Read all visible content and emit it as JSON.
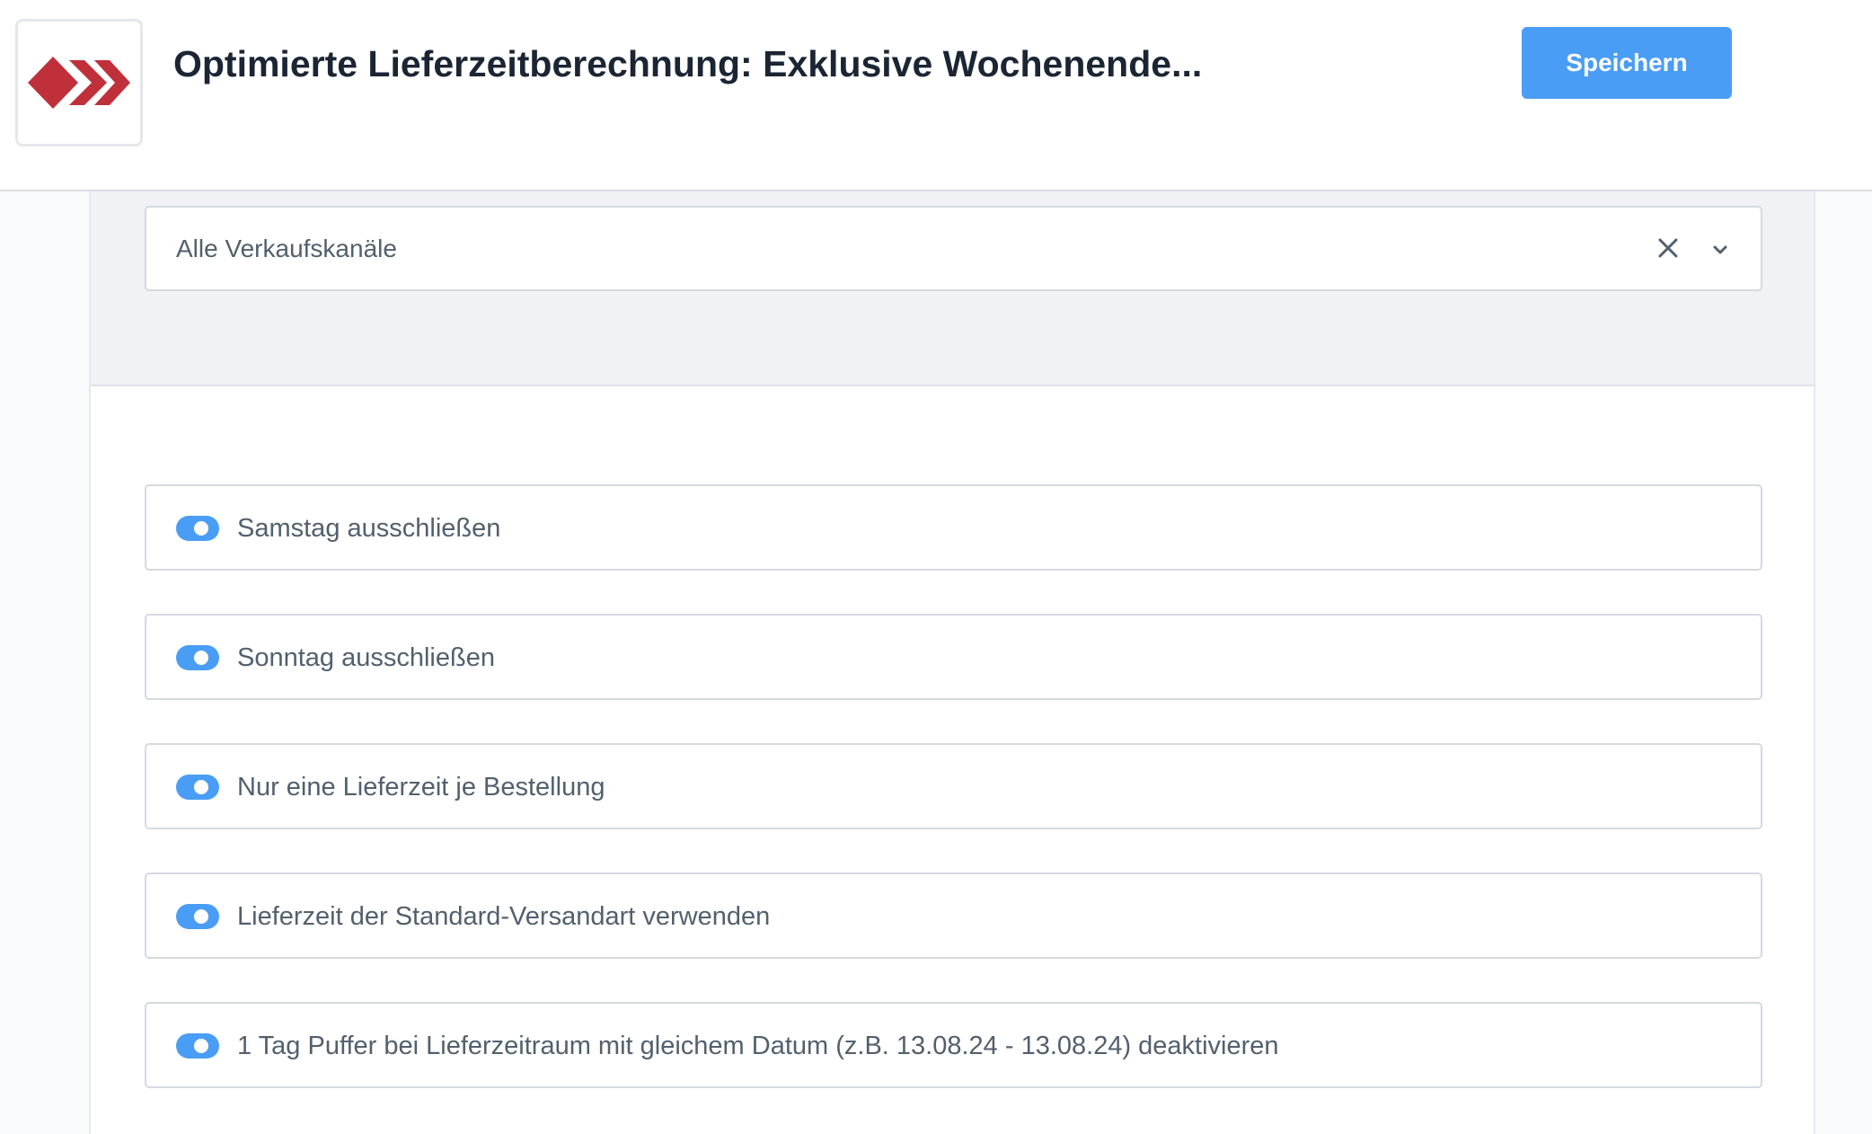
{
  "header": {
    "title": "Optimierte Lieferzeitberechnung: Exklusive Wochenende...",
    "save_label": "Speichern",
    "logo_icon": "red-diamond-chevrons-logo",
    "accent_color": "#4a9df5"
  },
  "filter": {
    "sales_channel_value": "Alle Verkaufskanäle",
    "clear_icon": "close-icon",
    "dropdown_icon": "chevron-down-icon"
  },
  "options": [
    {
      "label": "Samstag ausschließen",
      "enabled": true
    },
    {
      "label": "Sonntag ausschließen",
      "enabled": true
    },
    {
      "label": "Nur eine Lieferzeit je Bestellung",
      "enabled": true
    },
    {
      "label": "Lieferzeit der Standard-Versandart verwenden",
      "enabled": true
    },
    {
      "label": "1 Tag Puffer bei Lieferzeitraum mit gleichem Datum (z.B. 13.08.24 - 13.08.24) deaktivieren",
      "enabled": true
    }
  ]
}
